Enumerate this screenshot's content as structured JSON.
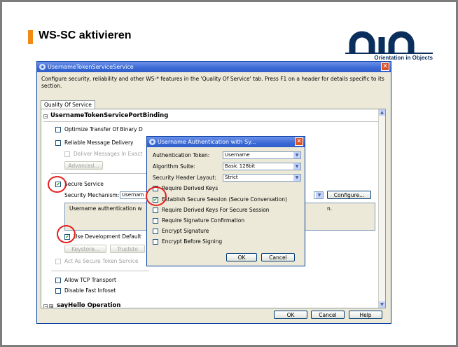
{
  "slide": {
    "title": "WS-SC aktivieren",
    "logo_tagline": "Orientation in Objects"
  },
  "window": {
    "title": "UsernameTokenServiceService",
    "description": "Configure security, reliability and other WS-* features in the 'Quality Of Service' tab. Press F1 on a header for details specific to its section.",
    "tab": "Quality Of Service",
    "binding_header": "UsernameTokenServicePortBinding",
    "optimize_label": "Optimize Transfer Of Binary D",
    "reliable_label": "Reliable Message Delivery",
    "deliver_label": "Deliver Messages In Exact",
    "advanced_button": "Advanced...",
    "secure_service_label": "Secure Service",
    "security_mechanism_label": "Security Mechanism:",
    "security_mechanism_value": "Usernam",
    "configure_button": "Configure...",
    "textarea_text": "Username authentication w",
    "textarea_tail": "n.",
    "dev_defaults_label": "Use Development Default",
    "keystore_button": "Keystore...",
    "truststore_button": "Truststo",
    "act_as_sts_label": "Act As Secure Token Service",
    "allow_tcp_label": "Allow TCP Transport",
    "disable_fi_label": "Disable Fast Infoset",
    "operation_header": "sayHello Operation",
    "ok_button": "OK",
    "cancel_button": "Cancel",
    "help_button": "Help"
  },
  "dialog": {
    "title": "Username Authentication with Sy...",
    "auth_token_label": "Authentication Token:",
    "auth_token_value": "Username",
    "algo_label": "Algorithm Suite:",
    "algo_value": "Basic 128bit",
    "layout_label": "Security Header Layout:",
    "layout_value": "Strict",
    "options": [
      {
        "label": "Require Derived Keys",
        "checked": false
      },
      {
        "label": "Establish Secure Session (Secure Conversation)",
        "checked": true
      },
      {
        "label": "Require Derived Keys For Secure Session",
        "checked": false
      },
      {
        "label": "Require Signature Confirmation",
        "checked": false
      },
      {
        "label": "Encrypt Signature",
        "checked": false
      },
      {
        "label": "Encrypt Before Signing",
        "checked": false
      }
    ],
    "ok_button": "OK",
    "cancel_button": "Cancel"
  },
  "colors": {
    "accent": "#f28a16",
    "logo": "#0b2f5c",
    "highlight_circle": "#e41f1f",
    "titlebar": "#3b6ad6"
  }
}
